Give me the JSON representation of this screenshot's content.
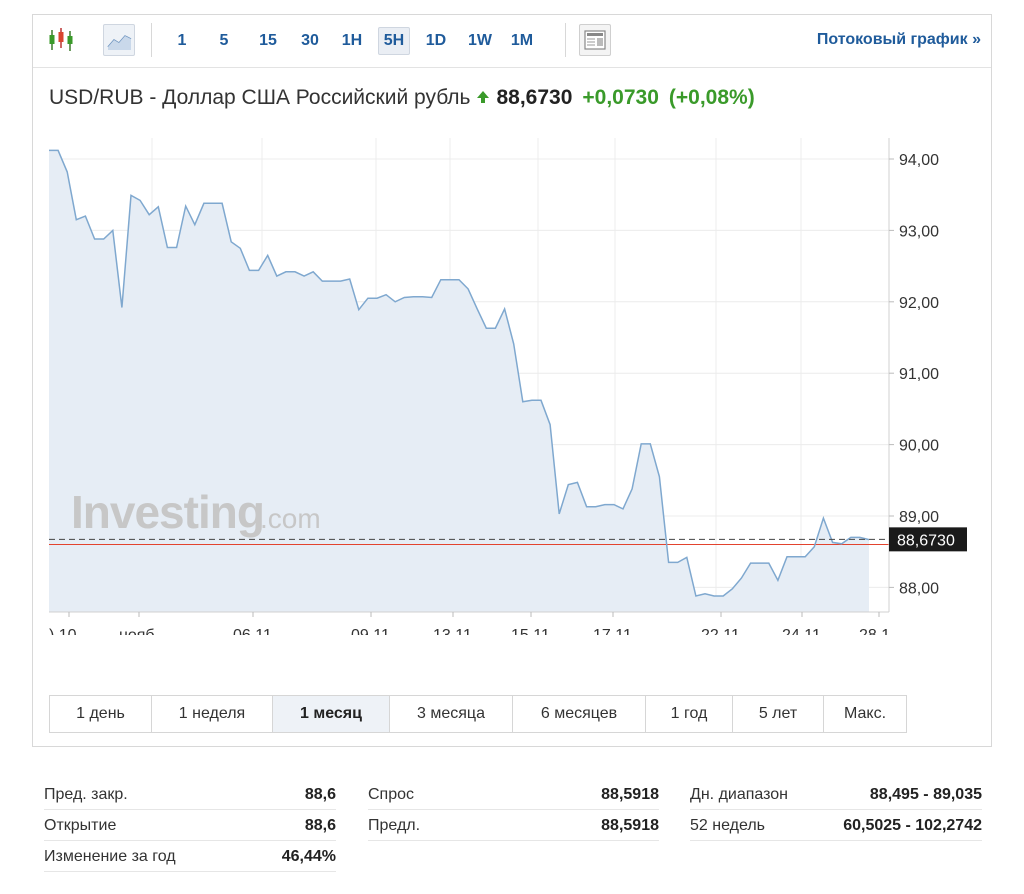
{
  "toolbar": {
    "intervals": [
      {
        "label": "1",
        "active": false
      },
      {
        "label": "5",
        "active": false
      },
      {
        "label": "15",
        "active": false
      },
      {
        "label": "30",
        "active": false
      },
      {
        "label": "1H",
        "active": false
      },
      {
        "label": "5H",
        "active": true
      },
      {
        "label": "1D",
        "active": false
      },
      {
        "label": "1W",
        "active": false
      },
      {
        "label": "1M",
        "active": false
      }
    ],
    "stream_link": "Потоковый график »",
    "icons": [
      "candlestick-chart-icon",
      "area-chart-icon",
      "news-layout-icon"
    ]
  },
  "header": {
    "title": "USD/RUB - Доллар США Российский рубль",
    "price": "88,6730",
    "change": "+0,0730",
    "change_pct": "(+0,08%)",
    "up_color": "#3a9a2a"
  },
  "chart": {
    "watermark_main": "Investing",
    "watermark_suffix": ".com",
    "current_label": "88,6730",
    "line_color": "#7fa8cf",
    "fill_color": "#e6edf5",
    "prev_close_line_color": "#e3432e"
  },
  "chart_data": {
    "type": "area",
    "y_ticks": [
      "94,00",
      "93,00",
      "92,00",
      "91,00",
      "90,00",
      "89,00",
      "88,00"
    ],
    "x_ticks": [
      ").10",
      "нояб",
      "06.11",
      "09.11",
      "13.11",
      "15.11",
      "17.11",
      "22.11",
      "24.11",
      "28.1"
    ],
    "ylim": [
      87.65,
      94.3
    ],
    "current_value": 88.673,
    "prev_close": 88.6,
    "series": [
      {
        "values": [
          94.12,
          94.12,
          93.82,
          93.15,
          93.2,
          92.88,
          92.88,
          93.0,
          91.92,
          93.49,
          93.42,
          93.22,
          93.33,
          92.76,
          92.76,
          93.34,
          93.08,
          93.38,
          93.38,
          93.38,
          92.84,
          92.75,
          92.44,
          92.44,
          92.65,
          92.36,
          92.42,
          92.42,
          92.36,
          92.42,
          92.29,
          92.29,
          92.29,
          92.32,
          91.89,
          92.05,
          92.05,
          92.1,
          92.0,
          92.06,
          92.07,
          92.07,
          92.06,
          92.31,
          92.31,
          92.31,
          92.18,
          91.9,
          91.63,
          91.63,
          91.9,
          91.41,
          90.6,
          90.62,
          90.62,
          90.28,
          89.03,
          89.44,
          89.47,
          89.13,
          89.13,
          89.16,
          89.16,
          89.1,
          89.38,
          90.01,
          90.01,
          89.55,
          88.35,
          88.35,
          88.42,
          87.88,
          87.91,
          87.88,
          87.88,
          87.98,
          88.13,
          88.34,
          88.34,
          88.34,
          88.1,
          88.43,
          88.43,
          88.43,
          88.57,
          88.97,
          88.63,
          88.61,
          88.7,
          88.7,
          88.67
        ]
      }
    ]
  },
  "periods": [
    {
      "label": "1 день",
      "active": false
    },
    {
      "label": "1 неделя",
      "active": false
    },
    {
      "label": "1 месяц",
      "active": true
    },
    {
      "label": "3 месяца",
      "active": false
    },
    {
      "label": "6 месяцев",
      "active": false
    },
    {
      "label": "1 год",
      "active": false
    },
    {
      "label": "5 лет",
      "active": false
    },
    {
      "label": "Макс.",
      "active": false
    }
  ],
  "stats": {
    "col1": [
      {
        "label": "Пред. закр.",
        "value": "88,6"
      },
      {
        "label": "Открытие",
        "value": "88,6"
      },
      {
        "label": "Изменение за год",
        "value": "46,44%"
      }
    ],
    "col2": [
      {
        "label": "Спрос",
        "value": "88,5918"
      },
      {
        "label": "Предл.",
        "value": "88,5918"
      }
    ],
    "col3": [
      {
        "label": "Дн. диапазон",
        "value": "88,495 - 89,035"
      },
      {
        "label": "52 недель",
        "value": "60,5025 - 102,2742"
      }
    ]
  }
}
